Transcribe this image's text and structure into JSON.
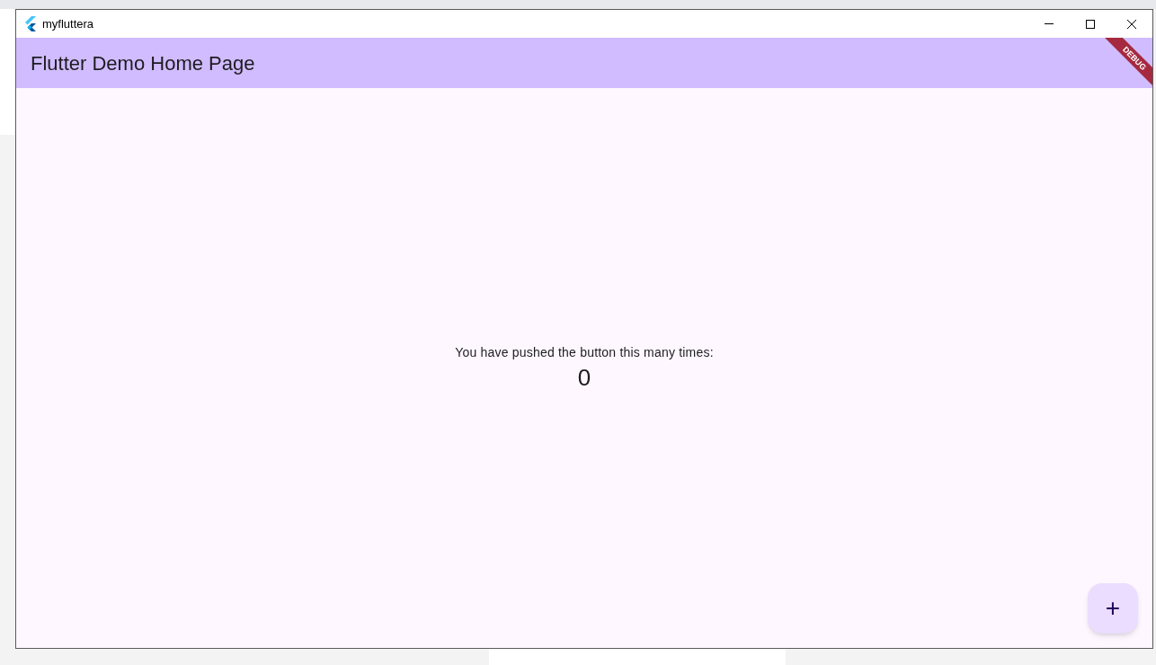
{
  "window": {
    "title": "myfluttera"
  },
  "app_bar": {
    "title": "Flutter Demo Home Page"
  },
  "debug_banner": {
    "label": "DEBUG"
  },
  "body": {
    "message": "You have pushed the button this many times:",
    "counter": "0"
  },
  "fab": {
    "icon": "+"
  }
}
